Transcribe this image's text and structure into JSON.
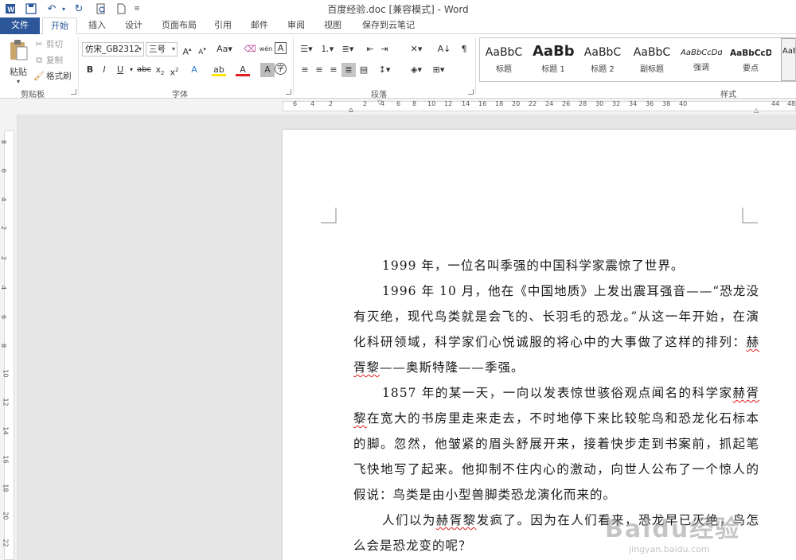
{
  "window": {
    "title": "百度经验.doc [兼容模式] - Word"
  },
  "tabs": [
    {
      "label": "文件"
    },
    {
      "label": "开始"
    },
    {
      "label": "插入"
    },
    {
      "label": "设计"
    },
    {
      "label": "页面布局"
    },
    {
      "label": "引用"
    },
    {
      "label": "邮件"
    },
    {
      "label": "审阅"
    },
    {
      "label": "视图"
    },
    {
      "label": "保存到云笔记"
    }
  ],
  "clipboard": {
    "paste": "粘贴",
    "cut": "剪切",
    "copy": "复制",
    "format_painter": "格式刷",
    "group": "剪贴板"
  },
  "font": {
    "name": "仿宋_GB2312",
    "size": "三号",
    "group": "字体"
  },
  "paragraph": {
    "group": "段落"
  },
  "styles": {
    "group": "样式",
    "items": [
      {
        "sample": "AaBbC",
        "name": "标题"
      },
      {
        "sample": "AaBb",
        "name": "标题 1"
      },
      {
        "sample": "AaBbC",
        "name": "标题 2"
      },
      {
        "sample": "AaBbC",
        "name": "副标题"
      },
      {
        "sample": "AaBbCcDd",
        "name": "强调"
      },
      {
        "sample": "AaBbCcD",
        "name": "要点"
      },
      {
        "sample": "AaBb",
        "name": ""
      }
    ]
  },
  "ruler": {
    "h_ticks": [
      "6",
      "4",
      "2",
      "2",
      "4",
      "6",
      "8",
      "10",
      "12",
      "14",
      "16",
      "18",
      "20",
      "22",
      "24",
      "26",
      "28",
      "30",
      "32",
      "34",
      "36",
      "38",
      "40",
      "44",
      "48"
    ],
    "v_ticks": [
      "8",
      "6",
      "4",
      "2",
      "2",
      "4",
      "6",
      "8",
      "10",
      "12",
      "14",
      "16",
      "18",
      "20",
      "22"
    ]
  },
  "document": {
    "p1": "1999 年，一位名叫季强的中国科学家震惊了世界。",
    "p2_a": "1996 年 10 月，他在《中国地质》上发出震耳强音——“恐龙没有灭绝，现代鸟类就是会飞的、长羽毛的恐龙。”从这一年开始，在演化科研领域，科学家们心悦诚服的将心中的大事做了这样的排列：",
    "p2_name": "赫胥黎",
    "p2_b": "——奥斯特隆——季强。",
    "p3_a": "1857 年的某一天，一向以发表惊世骇俗观点闻名的科学家",
    "p3_name": "赫胥黎",
    "p3_b": "在宽大的书房里走来走去，不时地停下来比较鸵鸟和恐龙化石标本的脚。忽然，他皱紧的眉头舒展开来，接着快步走到书案前，抓起笔飞快地写了起来。他抑制不住内心的激动，向世人公布了一个惊人的假说：鸟类是由小型兽脚类恐龙演化而来的。",
    "p4_a": "人们以为",
    "p4_name": "赫胥黎",
    "p4_b": "发疯了。因为在人们看来，恐龙早已灭绝，鸟怎么会是恐龙变的呢？"
  },
  "watermark": {
    "main": "Baidu经验",
    "sub": "jingyan.baidu.com"
  }
}
